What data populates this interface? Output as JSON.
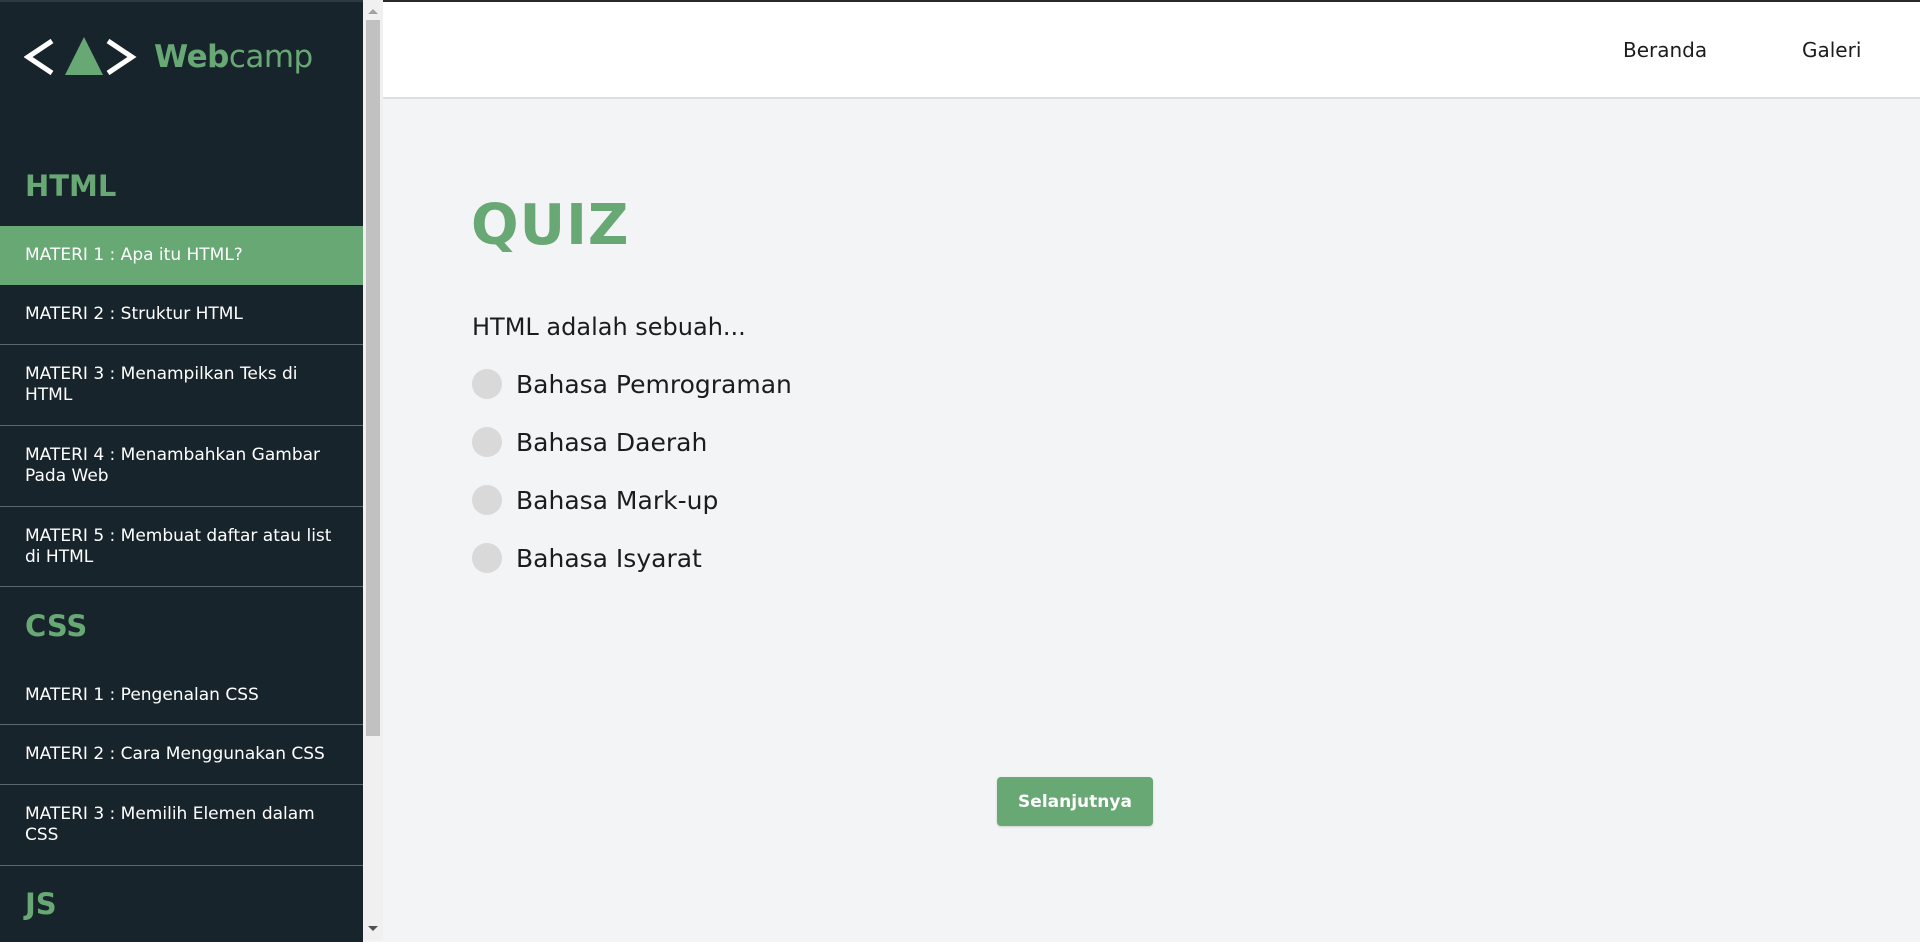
{
  "logo": {
    "text_bold": "Web",
    "text_light": "camp"
  },
  "sidebar": {
    "sections": [
      {
        "title": "HTML",
        "items": [
          {
            "label": "MATERI 1 : Apa itu HTML?",
            "active": true
          },
          {
            "label": "MATERI 2 : Struktur HTML"
          },
          {
            "label": "MATERI 3 : Menampilkan Teks di HTML"
          },
          {
            "label": "MATERI 4 : Menambahkan Gambar Pada Web"
          },
          {
            "label": "MATERI 5 : Membuat daftar atau list di HTML"
          }
        ]
      },
      {
        "title": "CSS",
        "items": [
          {
            "label": "MATERI 1 : Pengenalan CSS"
          },
          {
            "label": "MATERI 2 : Cara Menggunakan CSS"
          },
          {
            "label": "MATERI 3 : Memilih Elemen dalam CSS"
          }
        ]
      },
      {
        "title": "JS",
        "items": []
      }
    ]
  },
  "header": {
    "nav": [
      "Beranda",
      "Galeri"
    ]
  },
  "quiz": {
    "title": "QUIZ",
    "question": "HTML adalah sebuah...",
    "options": [
      "Bahasa Pemrograman",
      "Bahasa Daerah",
      "Bahasa Mark-up",
      "Bahasa Isyarat"
    ],
    "next_label": "Selanjutnya"
  },
  "colors": {
    "accent": "#68a874",
    "sidebar_bg": "#18242c",
    "page_bg": "#f3f4f6"
  }
}
